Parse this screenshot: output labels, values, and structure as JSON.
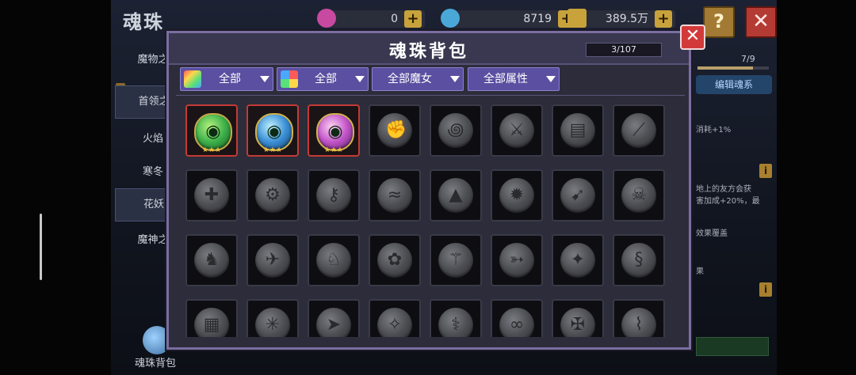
{
  "page": {
    "title": "魂珠"
  },
  "resources": [
    {
      "name": "gem",
      "value": "0",
      "icon": "pink-gem-icon",
      "color": "#c84aa0"
    },
    {
      "name": "diamond",
      "value": "8719",
      "icon": "blue-diamond-icon",
      "color": "#4aa8d8"
    },
    {
      "name": "gold",
      "value": "389.5万",
      "icon": "gold-chest-icon",
      "color": "#c8a23a"
    }
  ],
  "top_buttons": {
    "help": "?",
    "close": "✕"
  },
  "sidebar": {
    "items": [
      {
        "label": "魔物之"
      },
      {
        "label": "首领之"
      },
      {
        "label": "火焰"
      },
      {
        "label": "寒冬"
      },
      {
        "label": "花妖"
      },
      {
        "label": "魔神之"
      }
    ],
    "bag_label": "魂珠背包"
  },
  "right_panel": {
    "count": "7/9",
    "edit_button": "编辑魂系",
    "text1": "消耗+1%",
    "text2": "地上的友方会获",
    "text3": "害加成+20%，最",
    "text4": "效果覆盖",
    "text5": "果"
  },
  "modal": {
    "title": "魂珠背包",
    "count": "3/107",
    "close": "✕",
    "filters": [
      {
        "label": "全部",
        "icon": "rainbow-filter-icon"
      },
      {
        "label": "全部",
        "icon": "color-grid-filter-icon"
      },
      {
        "label": "全部魔女",
        "icon": ""
      },
      {
        "label": "全部属性",
        "icon": ""
      }
    ],
    "slots_owned": [
      {
        "icon": "green-serpent-orb-icon",
        "stars": "★★★",
        "style": "g1"
      },
      {
        "icon": "blue-crystal-orb-icon",
        "stars": "★★★",
        "style": "g2"
      },
      {
        "icon": "purple-crystal-orb-icon",
        "stars": "★★★",
        "style": "g3"
      }
    ],
    "slot_icons_locked": [
      "fist-rune-icon",
      "swirl-rune-icon",
      "blade-rune-icon",
      "book-rune-icon",
      "sword-rune-icon",
      "claw-rune-icon",
      "gear-rune-icon",
      "key-rune-icon",
      "wave-rune-icon",
      "hat-rune-icon",
      "crab-rune-icon",
      "drill-rune-icon",
      "skull-rune-icon",
      "dragon-rune-icon",
      "wing-rune-icon",
      "beast-rune-icon",
      "flower-rune-icon",
      "wand-rune-icon",
      "arrow-rune-icon",
      "star-rune-icon",
      "serpent-rune-icon",
      "maze-rune-icon",
      "spider-rune-icon",
      "fish-rune-icon",
      "bird-rune-icon",
      "staff-rune-icon",
      "twist-rune-icon",
      "cross-rune-icon",
      "hook-rune-icon"
    ]
  }
}
